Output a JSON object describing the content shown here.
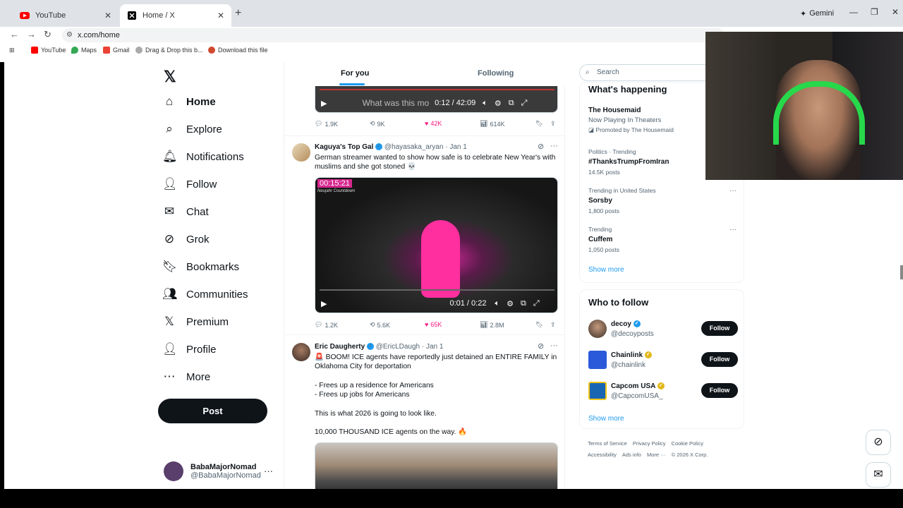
{
  "browser": {
    "tabs": [
      {
        "label": "YouTube",
        "active": false
      },
      {
        "label": "Home / X",
        "active": true
      }
    ],
    "gemini_label": "Gemini",
    "url": "x.com/home",
    "bookmarks": [
      "YouTube",
      "Maps",
      "Gmail",
      "Drag & Drop this b...",
      "Download this file"
    ]
  },
  "sidebar": {
    "items": [
      {
        "label": "Home",
        "icon": "home-icon"
      },
      {
        "label": "Explore",
        "icon": "search-icon"
      },
      {
        "label": "Notifications",
        "icon": "bell-icon"
      },
      {
        "label": "Follow",
        "icon": "person-plus-icon"
      },
      {
        "label": "Chat",
        "icon": "mail-icon"
      },
      {
        "label": "Grok",
        "icon": "grok-icon"
      },
      {
        "label": "Bookmarks",
        "icon": "bookmark-icon"
      },
      {
        "label": "Communities",
        "icon": "people-icon"
      },
      {
        "label": "Premium",
        "icon": "x-icon"
      },
      {
        "label": "Profile",
        "icon": "person-icon"
      },
      {
        "label": "More",
        "icon": "more-circle-icon"
      }
    ],
    "post_label": "Post",
    "account": {
      "name": "BabaMajorNomad",
      "handle": "@BabaMajorNomad"
    }
  },
  "feed": {
    "tabs": [
      "For you",
      "Following"
    ],
    "top_video": {
      "caption": "What was this mo",
      "time": "0:12 / 42:09"
    },
    "top_actions": {
      "replies": "1.9K",
      "reposts": "9K",
      "likes": "42K",
      "views": "614K"
    },
    "posts": [
      {
        "name": "Kaguya's Top Gal",
        "handle": "@hayasaka_aryan",
        "date": "· Jan 1",
        "text": "German streamer wanted to show how safe is to celebrate New Year's with muslims and she got stoned 💀",
        "video_overlay": "00:15:21",
        "video_sub": "Neujahr Countdown",
        "video_time": "0:01 / 0:22",
        "actions": {
          "replies": "1.2K",
          "reposts": "5.6K",
          "likes": "65K",
          "views": "2.8M"
        }
      },
      {
        "name": "Eric Daugherty",
        "handle": "@EricLDaugh",
        "date": "· Jan 1",
        "lines": [
          "🚨 BOOM! ICE agents have reportedly just detained an ENTIRE FAMILY in Oklahoma City for deportation",
          "- Frees up a residence for Americans",
          "- Frees up jobs for Americans",
          "This is what 2026 is going to look like.",
          "10,000 THOUSAND ICE agents on the way. 🔥"
        ]
      }
    ]
  },
  "right": {
    "search_placeholder": "Search",
    "happening_title": "What's happening",
    "trends": [
      {
        "context": "",
        "name": "The Housemaid",
        "sub": "Now Playing In Theaters",
        "extra": "Promoted by The Housemaid"
      },
      {
        "context": "Politics · Trending",
        "name": "#ThanksTrumpFromIran",
        "sub": "14.5K posts"
      },
      {
        "context": "Trending in United States",
        "name": "Sorsby",
        "sub": "1,800 posts"
      },
      {
        "context": "Trending",
        "name": "Cuffem",
        "sub": "1,050 posts"
      }
    ],
    "show_more": "Show more",
    "who_title": "Who to follow",
    "who": [
      {
        "name": "decoy",
        "handle": "@decoyposts",
        "button": "Follow"
      },
      {
        "name": "Chainlink",
        "handle": "@chainlink",
        "button": "Follow"
      },
      {
        "name": "Capcom USA",
        "handle": "@CapcomUSA_",
        "button": "Follow"
      }
    ],
    "footer": [
      "Terms of Service",
      "Privacy Policy",
      "Cookie Policy",
      "Accessibility",
      "Ads info",
      "More ···",
      "© 2026 X Corp."
    ]
  }
}
